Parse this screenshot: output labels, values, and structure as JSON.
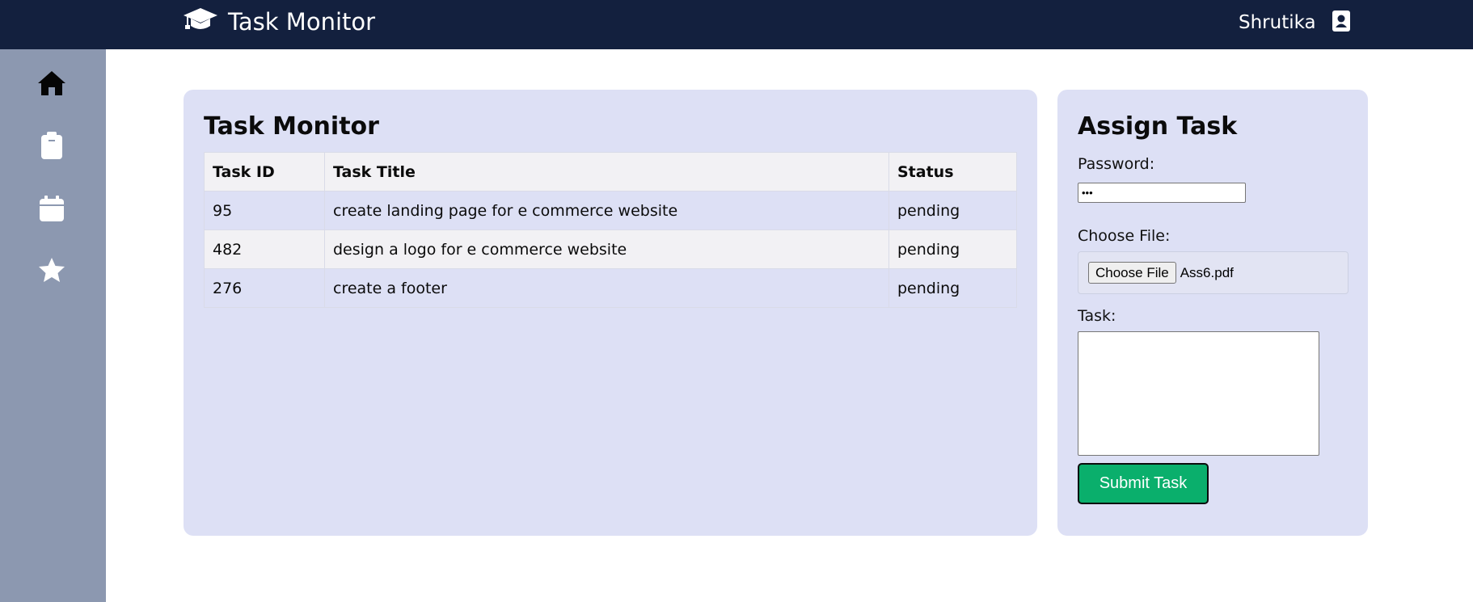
{
  "header": {
    "title": "Task Monitor",
    "logo_icon": "graduation-cap-icon",
    "user_name": "Shrutika",
    "profile_icon": "contact-card-icon"
  },
  "sidebar": {
    "items": [
      {
        "icon": "home-icon"
      },
      {
        "icon": "clipboard-icon"
      },
      {
        "icon": "calendar-icon"
      },
      {
        "icon": "star-icon"
      }
    ]
  },
  "monitor": {
    "title": "Task Monitor",
    "columns": [
      "Task ID",
      "Task Title",
      "Status"
    ],
    "rows": [
      {
        "id": "95",
        "title": "create landing page for e commerce website",
        "status": "pending"
      },
      {
        "id": "482",
        "title": "design a logo for e commerce website",
        "status": "pending"
      },
      {
        "id": "276",
        "title": "create a footer",
        "status": "pending"
      }
    ]
  },
  "assign": {
    "title": "Assign Task",
    "password_label": "Password:",
    "password_value": "•••",
    "file_label": "Choose File:",
    "file_button": "Choose File",
    "file_name": "Ass6.pdf",
    "task_label": "Task:",
    "task_value": "",
    "submit_label": "Submit Task"
  },
  "colors": {
    "topbar": "#13203e",
    "sidebar": "#8c98b0",
    "card": "#dde0f5",
    "submit": "#0aaf6c"
  }
}
